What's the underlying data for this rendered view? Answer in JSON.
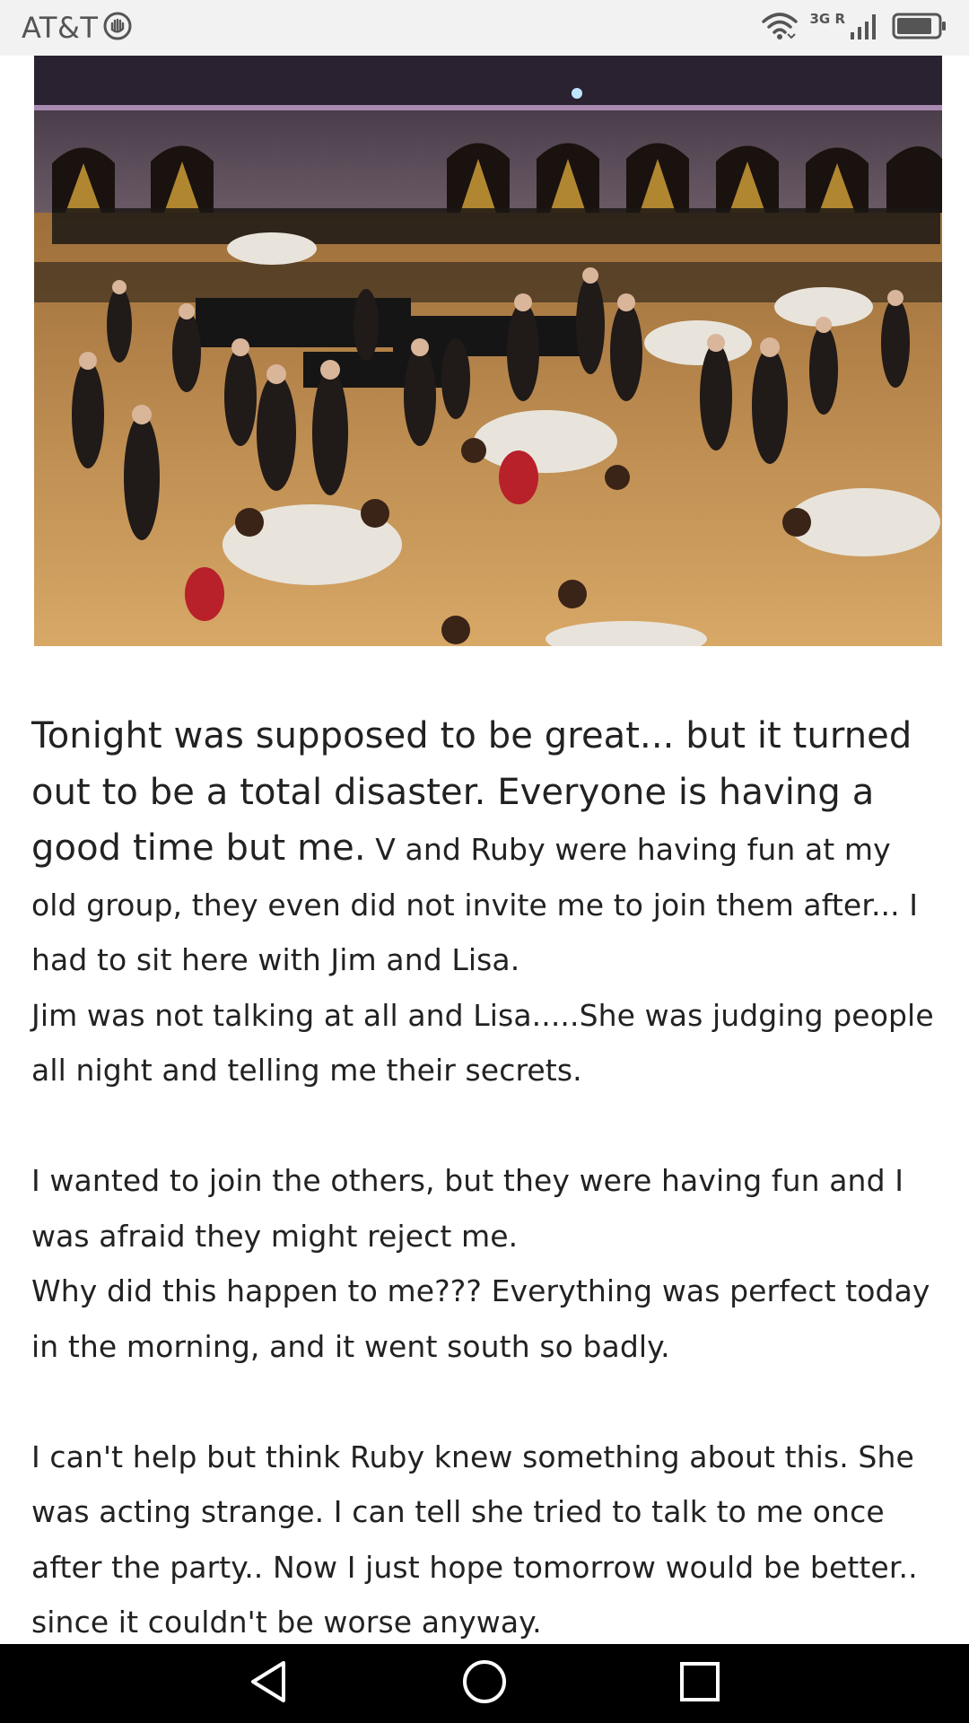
{
  "status_bar": {
    "carrier": "AT&T",
    "network": "3G R",
    "icons": [
      "hand-stop-icon",
      "wifi-icon",
      "cell-signal-icon",
      "battery-icon"
    ]
  },
  "photo": {
    "description_icon": "photo-banquet-hall"
  },
  "post": {
    "lead": "Tonight was supposed to be great... but it turned out to be a total disaster. Everyone is having a good time but me.",
    "lead_rest": " V and Ruby were having fun at my old group, they even did not invite me to join them after... I had to sit here with Jim and Lisa.",
    "p2": "Jim was not talking at all and Lisa.....She was judging people all night and telling me their secrets.",
    "p3": "I wanted to join the others, but they were having fun and I was afraid they might reject me.",
    "p4": "Why did this happen to me??? Everything was perfect today in the morning, and it went south so badly.",
    "p5": "I can't help but think Ruby knew something about this. She was acting strange. I can tell she tried to talk to me once after the party.. Now I just hope tomorrow would be better.. since it couldn't be worse anyway."
  },
  "nav_bar": {
    "buttons": [
      "back-icon",
      "home-icon",
      "recents-icon"
    ]
  },
  "colors": {
    "status_bg": "#f2f2f2",
    "text": "#222222",
    "nav_bg": "#000000"
  }
}
